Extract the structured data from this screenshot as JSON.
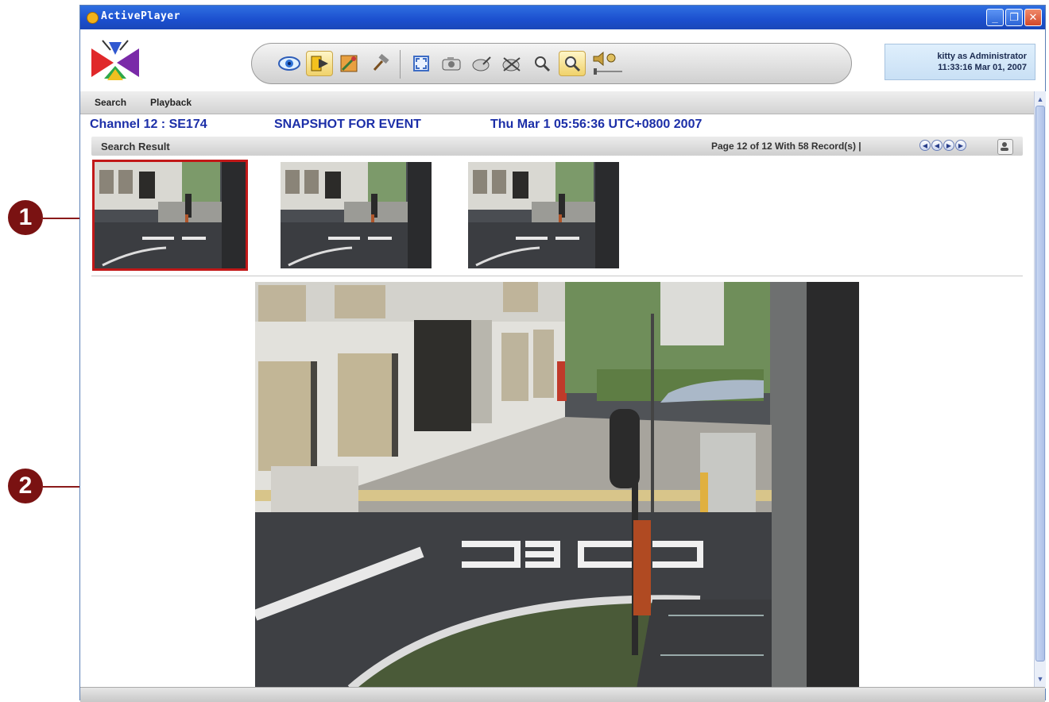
{
  "window": {
    "title": "ActivePlayer",
    "minimize": "_",
    "maximize": "❐",
    "close": "✕"
  },
  "menu": {
    "items": [
      {
        "label": "Search"
      },
      {
        "label": "Playback"
      }
    ]
  },
  "user": {
    "line1": "kitty as Administrator",
    "line2": "11:33:16 Mar 01, 2007"
  },
  "info": {
    "channel": "Channel  12 : SE174",
    "event": "SNAPSHOT FOR EVENT",
    "timestamp": "Thu Mar 1 05:56:36 UTC+0800 2007"
  },
  "results": {
    "label": "Search Result",
    "page_info": "Page 12 of 12 With 58 Record(s) |",
    "selected_index": 0,
    "thumbnail_count": 3
  },
  "callouts": [
    {
      "number": "1"
    },
    {
      "number": "2"
    }
  ],
  "icons": {
    "nav": [
      "first",
      "previous",
      "next",
      "last"
    ],
    "toolbar": [
      "live-view-eye",
      "playback",
      "event-config",
      "tools-hammer",
      "fullscreen",
      "snapshot",
      "record",
      "record-off",
      "zoom-in",
      "zoom-out",
      "audio-volume"
    ]
  },
  "colors": {
    "titlebar": "#1b4fcf",
    "info_text": "#1c2fa8",
    "selection_border": "#c21818",
    "callout": "#7a1212"
  }
}
